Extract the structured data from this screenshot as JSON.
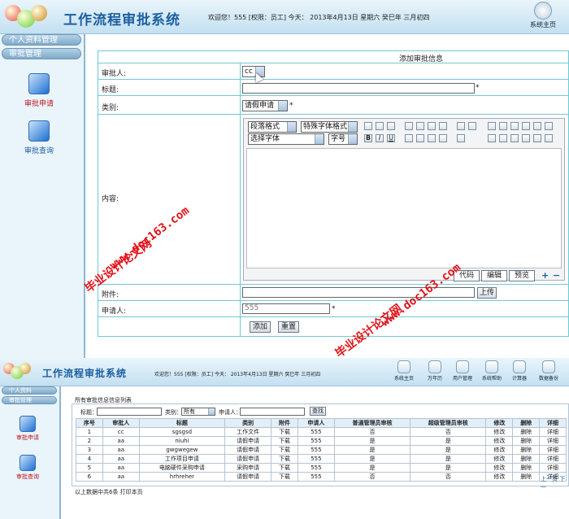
{
  "colors": {
    "accent": "#1d5fa0",
    "frame": "#6fc8d8",
    "watermark": "#e0141b"
  },
  "top": {
    "app_title": "工作流程审批系统",
    "user_info": "欢迎您！555 [权限：员工] 今天： 2013年4月13日 星期六 癸巳年 三月初四",
    "home_btn": "系统主页",
    "sidebar_menu": [
      "个人资料管理",
      "审批管理"
    ],
    "side_links": [
      {
        "label": "审批申请",
        "icon": "apply-icon"
      },
      {
        "label": "审批查询",
        "icon": "query-icon"
      }
    ],
    "form": {
      "header": "添加审批信息",
      "approver_label": "审批人:",
      "approver_value": "cc",
      "title_label": "标题:",
      "type_label": "类别:",
      "type_value": "请假申请",
      "content_label": "内容:",
      "para_format": "段落格式",
      "font_format": "特殊字体格式",
      "font_select": "选择字体",
      "font_size": "字号",
      "editor_tabs": [
        "代码",
        "编辑",
        "预览"
      ],
      "attach_label": "附件:",
      "upload_btn": "上传",
      "applicant_label": "申请人:",
      "applicant_value": "555",
      "add_btn": "添加",
      "reset_btn": "重置"
    }
  },
  "bottom": {
    "app_title": "工作流程审批系统",
    "user_info": "欢迎您！555 [权限：员工] 今天： 2013年4月13日 星期六 癸巳年 三月初四",
    "toolbar": [
      "系统主页",
      "万年历",
      "用户管理",
      "系统帮助",
      "计算器",
      "数据备份"
    ],
    "sidebar_menu": [
      "个人资料",
      "审批管理"
    ],
    "side_links": [
      "审批申请",
      "审批查询"
    ],
    "list_title": "所有审批信息信息列表",
    "filter": {
      "title_label": "标题：",
      "type_label": "类别：",
      "type_value": "所有",
      "applicant_label": "申请人：",
      "search_btn": "查找"
    },
    "columns": [
      "序号",
      "审批人",
      "标题",
      "类别",
      "附件",
      "申请人",
      "普通管理员审核",
      "超级管理员审核",
      "修改",
      "删除",
      "详细"
    ],
    "rows": [
      [
        "1",
        "cc",
        "sgsgsd",
        "工作文件",
        "下载",
        "555",
        "否",
        "否",
        "修改",
        "删除",
        "详细"
      ],
      [
        "2",
        "aa",
        "niuhi",
        "请假申请",
        "下载",
        "555",
        "是",
        "是",
        "修改",
        "删除",
        "详细"
      ],
      [
        "3",
        "aa",
        "gwgwegew",
        "请假申请",
        "下载",
        "555",
        "是",
        "是",
        "修改",
        "删除",
        "详细"
      ],
      [
        "4",
        "aa",
        "工作项目申请",
        "请假申请",
        "下载",
        "555",
        "是",
        "是",
        "修改",
        "删除",
        "详细"
      ],
      [
        "5",
        "aa",
        "电脑硬件采购申请",
        "采购申请",
        "下载",
        "555",
        "是",
        "是",
        "修改",
        "删除",
        "详细"
      ],
      [
        "6",
        "aa",
        "hrhreher",
        "请假申请",
        "下载",
        "555",
        "否",
        "否",
        "修改",
        "删除",
        "详细"
      ]
    ],
    "pager": "上一页 下一",
    "footer": "以上数据中共6条 打印本页"
  },
  "watermarks": [
    "www.doc163.com",
    "毕业设计论文网",
    "www.doc163.com",
    "毕业设计论文网"
  ]
}
